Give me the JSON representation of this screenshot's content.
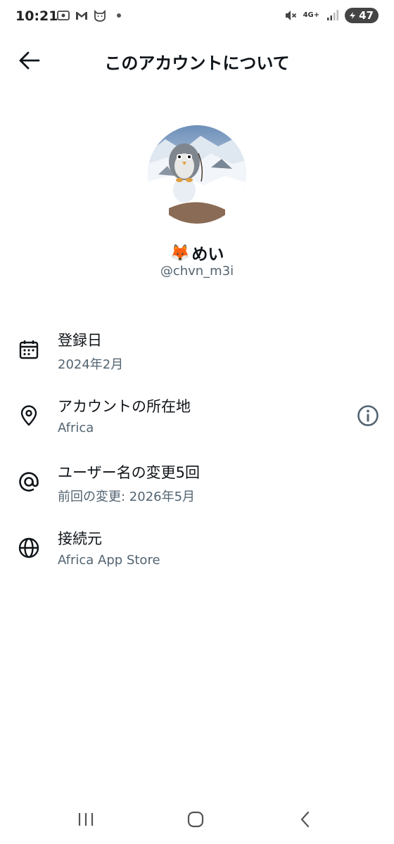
{
  "status_bar": {
    "time": "10:21",
    "network": "4G+",
    "battery": "47",
    "icons": [
      "screen-record-icon",
      "gmail-icon",
      "cat-app-icon",
      "notification-dot-icon",
      "mute-icon",
      "signal-icon",
      "battery-icon"
    ]
  },
  "header": {
    "title": "このアカウントについて",
    "back_icon": "arrow-left-icon"
  },
  "profile": {
    "emoji": "🦊",
    "name": "めい",
    "handle": "@chvn_m3i"
  },
  "info": [
    {
      "icon": "calendar-icon",
      "title": "登録日",
      "subtitle": "2024年2月"
    },
    {
      "icon": "location-pin-icon",
      "title": "アカウントの所在地",
      "subtitle": "Africa",
      "action_icon": "info-icon"
    },
    {
      "icon": "at-sign-icon",
      "title": "ユーザー名の変更5回",
      "subtitle": "前回の変更: 2026年5月"
    },
    {
      "icon": "globe-icon",
      "title": "接続元",
      "subtitle": "Africa App Store"
    }
  ],
  "nav_bar": {
    "icons": [
      "recent-apps-icon",
      "home-icon",
      "back-icon"
    ]
  },
  "colors": {
    "primary_text": "#0f1419",
    "secondary_text": "#536471",
    "background": "#ffffff"
  }
}
